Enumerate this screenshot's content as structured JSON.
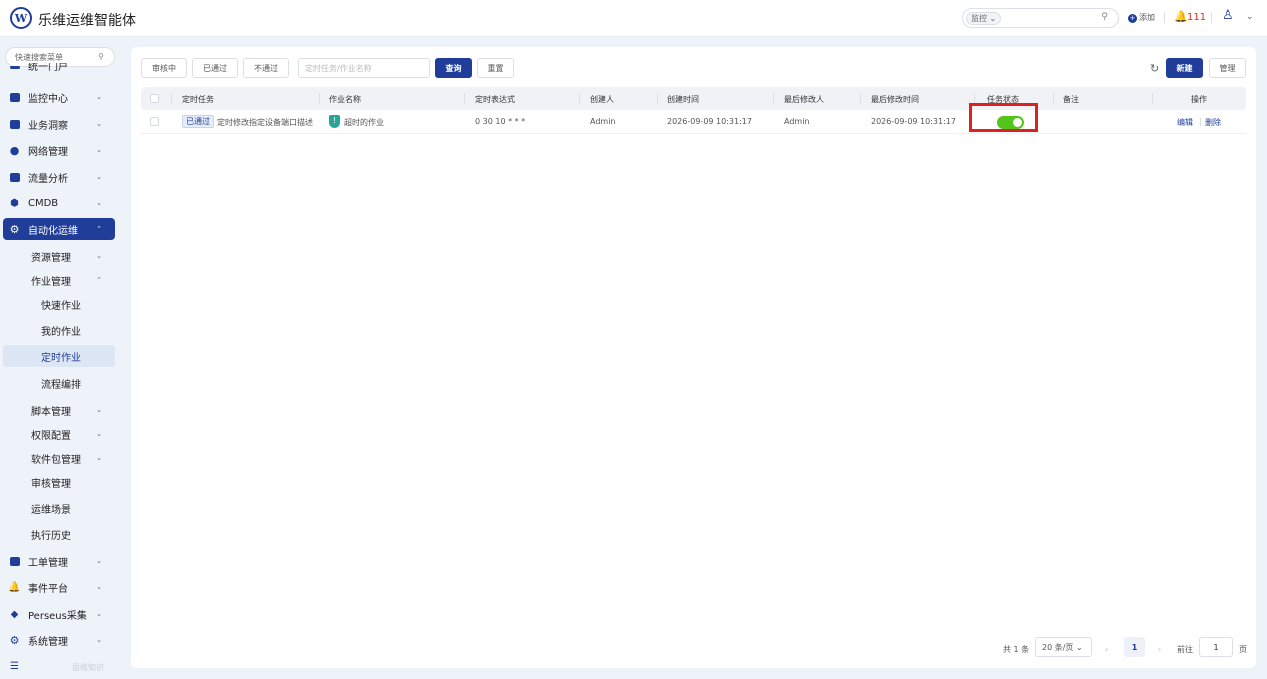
{
  "header": {
    "logo_letter": "W",
    "app_title": "乐维运维智能体",
    "search_scope": "监控",
    "search_value": "",
    "add_label": "添加",
    "alert_count": "111"
  },
  "sidebar": {
    "search_placeholder": "快速搜索菜单",
    "top_partial_label": "统一门户",
    "items": [
      {
        "label": "监控中心"
      },
      {
        "label": "业务洞察"
      },
      {
        "label": "网络管理"
      },
      {
        "label": "流量分析"
      },
      {
        "label": "CMDB"
      },
      {
        "label": "自动化运维"
      }
    ],
    "subitems": [
      {
        "label": "资源管理"
      },
      {
        "label": "作业管理"
      },
      {
        "label": "快速作业"
      },
      {
        "label": "我的作业"
      },
      {
        "label": "定时作业"
      },
      {
        "label": "流程编排"
      },
      {
        "label": "脚本管理"
      },
      {
        "label": "权限配置"
      },
      {
        "label": "软件包管理"
      },
      {
        "label": "审核管理"
      },
      {
        "label": "运维场景"
      },
      {
        "label": "执行历史"
      }
    ],
    "bottom_items": [
      {
        "label": "工单管理"
      },
      {
        "label": "事件平台"
      },
      {
        "label": "Perseus采集"
      },
      {
        "label": "系统管理"
      }
    ],
    "footer_text": "运维知识"
  },
  "toolbar": {
    "filters": [
      "审核中",
      "已通过",
      "不通过"
    ],
    "search_placeholder": "定时任务/作业名称",
    "query_label": "查询",
    "reset_label": "重置",
    "new_label": "新建",
    "manage_label": "管理"
  },
  "table": {
    "headers": [
      "定时任务",
      "作业名称",
      "定时表达式",
      "创建人",
      "创建时间",
      "最后修改人",
      "最后修改时间",
      "任务状态",
      "备注",
      "操作"
    ],
    "rows": [
      {
        "status_badge": "已通过",
        "task": "定时修改指定设备端口描述",
        "job": "超时的作业",
        "cron": "0 30 10 * * *",
        "creator": "Admin",
        "created": "2026-09-09 10:31:17",
        "modifier": "Admin",
        "modified": "2026-09-09 10:31:17",
        "enabled": true,
        "remark": "",
        "edit": "编辑",
        "delete": "删除"
      }
    ]
  },
  "pagination": {
    "total": "共 1 条",
    "page_size": "20 条/页",
    "current_page": "1",
    "goto_label": "前往",
    "goto_value": "1",
    "page_unit": "页"
  },
  "colors": {
    "primary": "#1f3d99",
    "switch_on": "#52c41a",
    "highlight": "#e01f1f",
    "alert": "#e02b2b"
  }
}
